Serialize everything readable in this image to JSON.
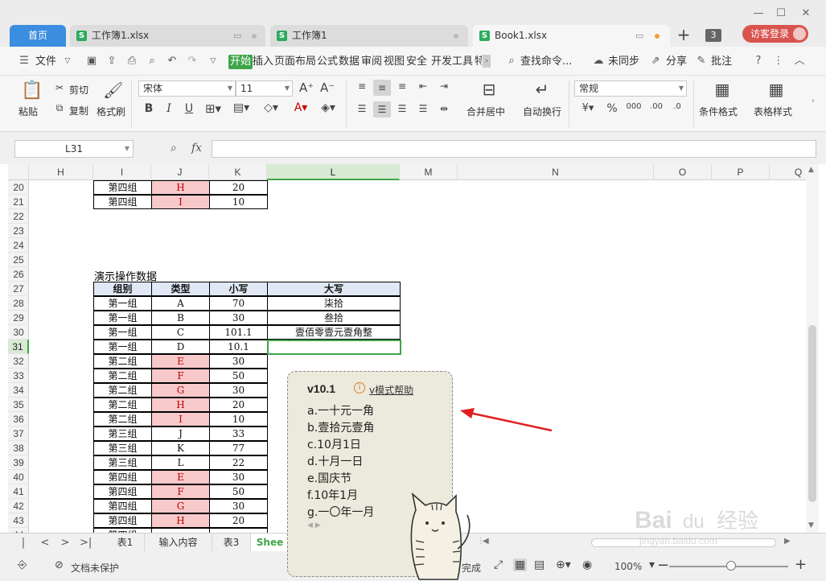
{
  "window": {
    "tabs": [
      {
        "label": "首页"
      },
      {
        "label": "工作簿1.xlsx"
      },
      {
        "label": "工作簿1"
      },
      {
        "label": "Book1.xlsx"
      }
    ],
    "tab_count": "3",
    "login_label": "访客登录"
  },
  "menu": {
    "file_label": "文件",
    "tabs": [
      "开始",
      "插入",
      "页面布局",
      "公式",
      "数据",
      "审阅",
      "视图",
      "安全",
      "开发工具",
      "特"
    ],
    "search_label": "查找命令...",
    "sync_label": "未同步",
    "share_label": "分享",
    "comment_label": "批注"
  },
  "ribbon": {
    "paste": "粘贴",
    "cut": "剪切",
    "copy": "复制",
    "format_painter": "格式刷",
    "font_name": "宋体",
    "font_size": "11",
    "merge_center": "合并居中",
    "wrap_text": "自动换行",
    "number_format": "常规",
    "conditional_format": "条件格式",
    "table_style": "表格样式"
  },
  "formula_bar": {
    "name_box": "L31",
    "fx": "fx",
    "formula": ""
  },
  "sheet": {
    "columns": [
      "H",
      "I",
      "J",
      "K",
      "L",
      "M",
      "N",
      "O",
      "P",
      "Q"
    ],
    "selected_column": "L",
    "rows": [
      "20",
      "21",
      "22",
      "23",
      "24",
      "25",
      "26",
      "27",
      "28",
      "29",
      "30",
      "31",
      "32",
      "33",
      "34",
      "35",
      "36",
      "37",
      "38",
      "39",
      "40",
      "41",
      "42",
      "43",
      "44"
    ],
    "selected_row": "31",
    "caption": "演示操作数据",
    "upper_rows": [
      {
        "group": "第四组",
        "type": "H",
        "small": "20"
      },
      {
        "group": "第四组",
        "type": "I",
        "small": "10"
      }
    ],
    "table_headers": [
      "组别",
      "类型",
      "小写",
      "大写"
    ],
    "table_rows": [
      {
        "group": "第一组",
        "type": "A",
        "small": "70",
        "big": "柒拾",
        "pink": false
      },
      {
        "group": "第一组",
        "type": "B",
        "small": "30",
        "big": "叁拾",
        "pink": false
      },
      {
        "group": "第一组",
        "type": "C",
        "small": "101.1",
        "big": "壹佰零壹元壹角整",
        "pink": false
      },
      {
        "group": "第一组",
        "type": "D",
        "small": "10.1",
        "big": "",
        "pink": false
      },
      {
        "group": "第二组",
        "type": "E",
        "small": "30",
        "big": "",
        "pink": true
      },
      {
        "group": "第二组",
        "type": "F",
        "small": "50",
        "big": "",
        "pink": true
      },
      {
        "group": "第二组",
        "type": "G",
        "small": "30",
        "big": "",
        "pink": true
      },
      {
        "group": "第二组",
        "type": "H",
        "small": "20",
        "big": "",
        "pink": true
      },
      {
        "group": "第二组",
        "type": "I",
        "small": "10",
        "big": "",
        "pink": true
      },
      {
        "group": "第三组",
        "type": "J",
        "small": "33",
        "big": "",
        "pink": false
      },
      {
        "group": "第三组",
        "type": "K",
        "small": "77",
        "big": "",
        "pink": false
      },
      {
        "group": "第三组",
        "type": "L",
        "small": "22",
        "big": "",
        "pink": false
      },
      {
        "group": "第四组",
        "type": "E",
        "small": "30",
        "big": "",
        "pink": true
      },
      {
        "group": "第四组",
        "type": "F",
        "small": "50",
        "big": "",
        "pink": true
      },
      {
        "group": "第四组",
        "type": "G",
        "small": "30",
        "big": "",
        "pink": true
      },
      {
        "group": "第四组",
        "type": "H",
        "small": "20",
        "big": "",
        "pink": true
      },
      {
        "group": "第四组",
        "type": "",
        "small": "",
        "big": "",
        "pink": false
      }
    ]
  },
  "sheet_tabs": [
    "表1",
    "输入内容",
    "表3",
    "Shee"
  ],
  "status": {
    "protect": "文档未保护",
    "finish": "完成",
    "zoom": "100%",
    "zoom_fraction": 0.52
  },
  "ime": {
    "input": "v10.1",
    "help": "v模式帮助",
    "candidates": [
      "a.一十元一角",
      "b.壹拾元壹角",
      "c.10月1日",
      "d.十月一日",
      "e.国庆节",
      "f.10年1月",
      "g.一〇年一月"
    ]
  },
  "watermark": {
    "brand": "Bai du 经验",
    "sub": "jingyan.baidu.com"
  },
  "colors": {
    "accent": "#3ea54a",
    "pink": "#f7c9cb",
    "header_fill": "#dfe8f4",
    "arrow": "#e02020",
    "login": "#d9534f"
  }
}
